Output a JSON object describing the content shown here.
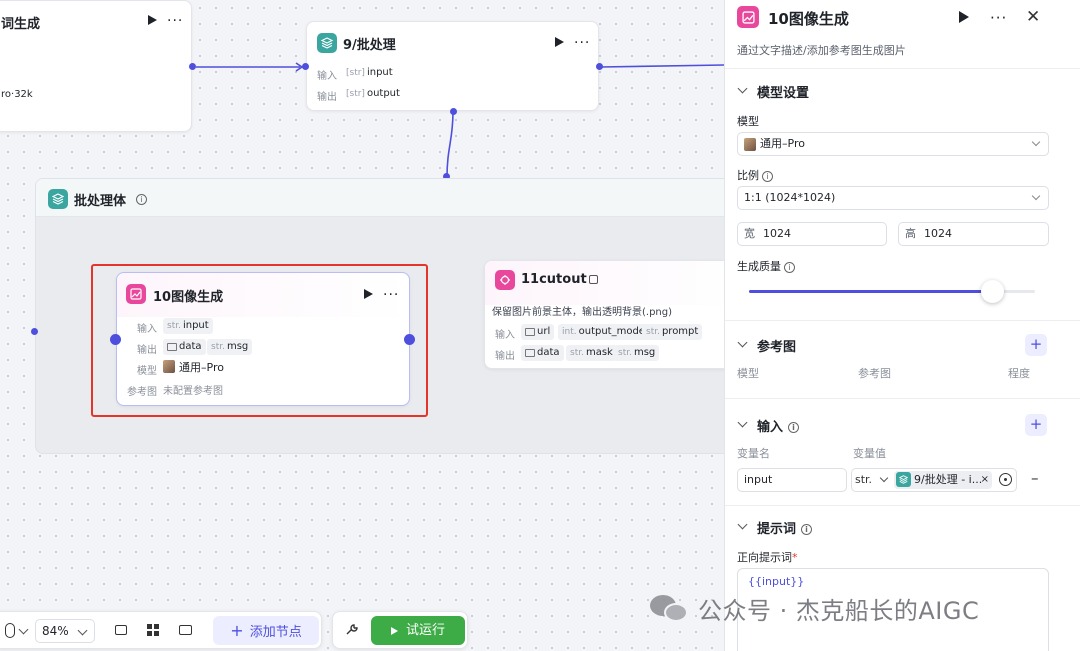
{
  "nodes": {
    "top_left": {
      "title": "词生成",
      "detail": "ro·32k"
    },
    "batch_node": {
      "title": "9/批处理",
      "input_label": "输入",
      "input_type": "[str]",
      "input_name": "input",
      "output_label": "输出",
      "output_type": "[str]",
      "output_name": "output"
    },
    "batch_body": {
      "title": "批处理体"
    },
    "image_node": {
      "title": "10图像生成",
      "input_label": "输入",
      "input_type": "str.",
      "input_name": "input",
      "output_label": "输出",
      "output_data": "data",
      "output_msg_type": "str.",
      "output_msg": "msg",
      "model_label": "模型",
      "model_value": "通用–Pro",
      "ref_label": "参考图",
      "ref_value": "未配置参考图"
    },
    "cutout_node": {
      "title": "11cutout",
      "desc": "保留图片前景主体，输出透明背景(.png)",
      "input_label": "输入",
      "in_url": "url",
      "in_mode_type": "int.",
      "in_mode": "output_mode",
      "in_prompt_type": "str.",
      "in_prompt": "prompt",
      "output_label": "输出",
      "out_data": "data",
      "out_mask_type": "str.",
      "out_mask": "mask",
      "out_msg_type": "str.",
      "out_msg": "msg"
    }
  },
  "toolbar": {
    "zoom": "84%",
    "add_node": "添加节点",
    "test_run": "试运行"
  },
  "panel": {
    "title": "10图像生成",
    "subtitle": "通过文字描述/添加参考图生成图片",
    "model_section": "模型设置",
    "model_label": "模型",
    "model_value": "通用–Pro",
    "ratio_label": "比例",
    "ratio_value": "1:1 (1024*1024)",
    "width_label": "宽",
    "width_value": "1024",
    "height_label": "高",
    "height_value": "1024",
    "quality_label": "生成质量",
    "quality_fraction": 0.85,
    "ref_section": "参考图",
    "ref_cols": [
      "模型",
      "参考图",
      "程度"
    ],
    "input_section": "输入",
    "var_name_col": "变量名",
    "var_value_col": "变量值",
    "var_name": "input",
    "var_type": "str.",
    "var_ref": "9/批处理 - i...",
    "prompt_section": "提示词",
    "positive_label": "正向提示词",
    "required_mark": "*",
    "prompt_value": "{{input}}"
  },
  "watermark": "公众号 · 杰克船长的AIGC",
  "colors": {
    "accent": "#4e4fdc",
    "run_green": "#3dab46",
    "highlight_red": "#e5352b"
  }
}
